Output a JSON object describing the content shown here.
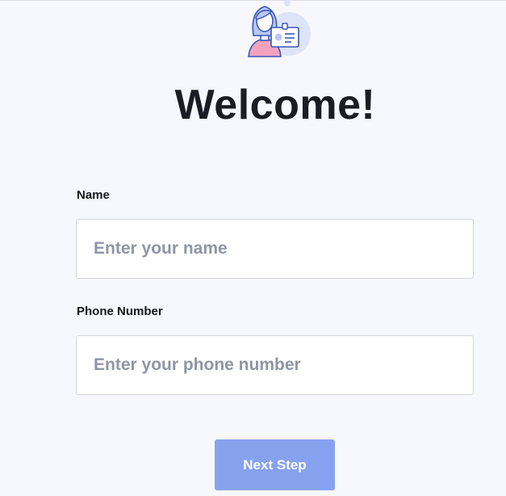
{
  "header": {
    "illustration_icon": "user-id-card-icon",
    "title": "Welcome!"
  },
  "form": {
    "name": {
      "label": "Name",
      "value": "",
      "placeholder": "Enter your name"
    },
    "phone": {
      "label": "Phone Number",
      "value": "",
      "placeholder": "Enter your phone number"
    },
    "next_label": "Next Step"
  },
  "colors": {
    "background": "#f7f8fd",
    "accent": "#86a2ef",
    "title_text": "#1c1d24",
    "placeholder_text": "#9095a3",
    "border": "#d3d5dc"
  }
}
